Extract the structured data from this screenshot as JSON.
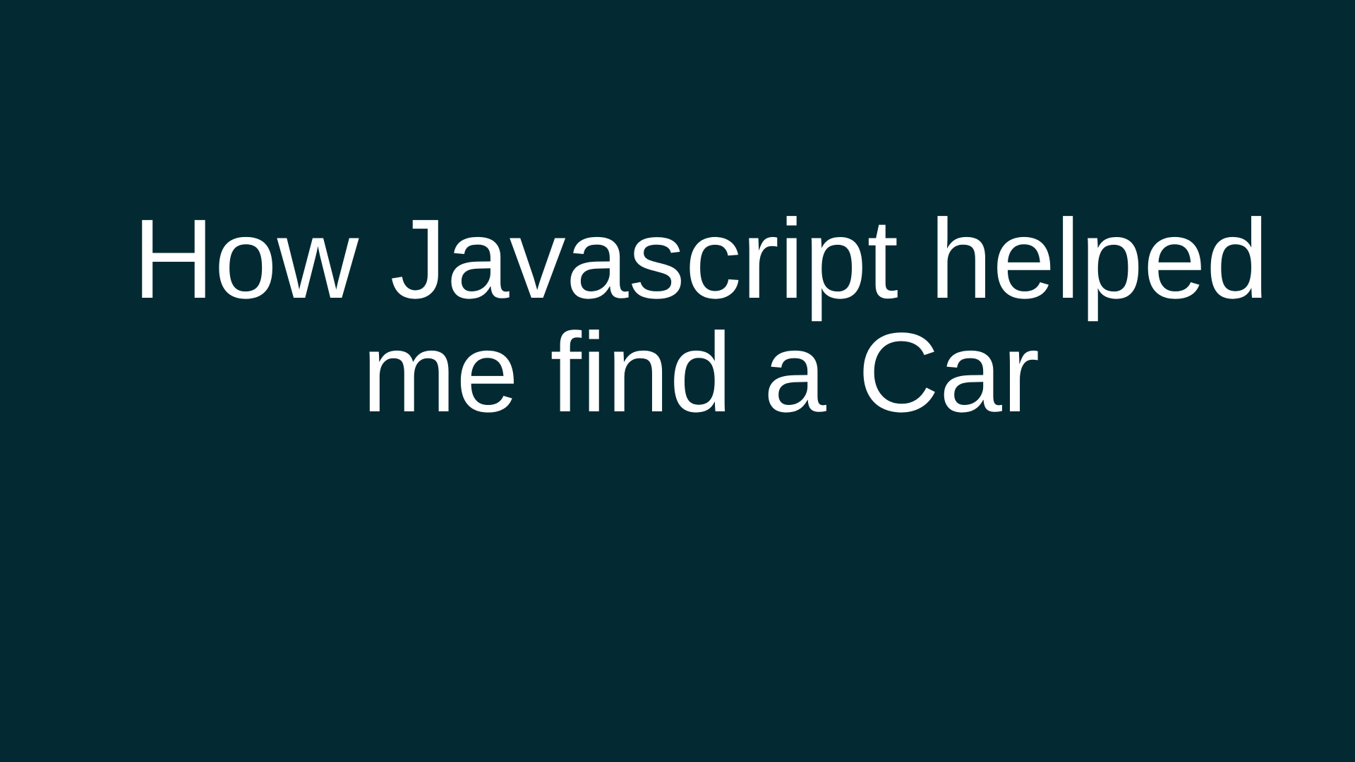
{
  "slide": {
    "background_color": "#032a33",
    "text_color": "#ffffff",
    "title_lines": [
      "How Javascript helped",
      "me find a Car"
    ]
  }
}
